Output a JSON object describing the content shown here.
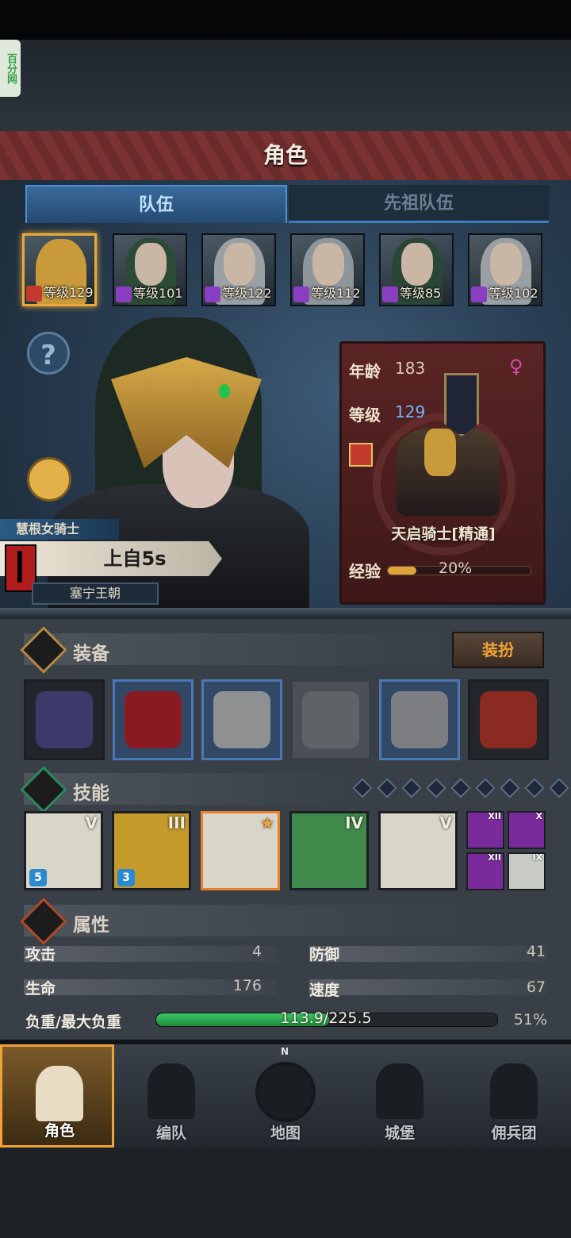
{
  "watermark": "百分网",
  "title": "角色",
  "tabs": [
    {
      "label": "队伍",
      "active": true
    },
    {
      "label": "先祖队伍",
      "active": false
    }
  ],
  "party": [
    {
      "level": "等级129",
      "icon": "horse-icon",
      "selected": true
    },
    {
      "level": "等级101",
      "icon": "wand-icon",
      "selected": false
    },
    {
      "level": "等级122",
      "icon": "wand-icon",
      "selected": false
    },
    {
      "level": "等级112",
      "icon": "wand-icon",
      "selected": false
    },
    {
      "level": "等级85",
      "icon": "wand-icon",
      "selected": false
    },
    {
      "level": "等级102",
      "icon": "wand-icon",
      "selected": false
    }
  ],
  "help_label": "?",
  "hero": {
    "class_title": "慧根女骑士",
    "name": "上自5s",
    "kingdom": "塞宁王朝"
  },
  "card": {
    "age_label": "年龄",
    "age": "183",
    "level_label": "等级",
    "level": "129",
    "gender_symbol": "♀",
    "class_name": "天启骑士[精通]",
    "exp_label": "经验",
    "exp_text": "20%",
    "exp_fraction": 0.2
  },
  "equipment": {
    "title": "装备",
    "outfit_button": "装扮",
    "slots": [
      {
        "name": "banner-lance-icon",
        "frame": "dark",
        "color": "#3b3a6a"
      },
      {
        "name": "red-tome-icon",
        "frame": "blue",
        "color": "#8a1a22"
      },
      {
        "name": "knight-helmet-icon",
        "frame": "blue",
        "color": "#8e9092"
      },
      {
        "name": "empty-armor-icon",
        "frame": "empty",
        "color": "#5e6368"
      },
      {
        "name": "steel-boots-icon",
        "frame": "blue",
        "color": "#7c7e82"
      },
      {
        "name": "bat-amulet-icon",
        "frame": "dark",
        "color": "#8a2a20"
      }
    ]
  },
  "skills": {
    "title": "技能",
    "gem_count": 9,
    "list": [
      {
        "name": "spear-guard-skill-icon",
        "rank": "V",
        "sub": "5",
        "bg": "#d9d6c9"
      },
      {
        "name": "holy-shield-skill-icon",
        "rank": "III",
        "sub": "3",
        "bg": "#c49a2a"
      },
      {
        "name": "crystal-wing-skill-icon",
        "rank": "★",
        "sub": "",
        "bg": "#d9d6c9"
      },
      {
        "name": "target-skill-icon",
        "rank": "IV",
        "sub": "",
        "bg": "#3f8a4a"
      },
      {
        "name": "crystal-arm-skill-icon",
        "rank": "V",
        "sub": "",
        "bg": "#d9d6c9"
      }
    ],
    "mini": [
      {
        "name": "arcane-star-skill-icon",
        "rank": "XII",
        "bg": "#7a2a9a"
      },
      {
        "name": "burst-skill-icon",
        "rank": "X",
        "bg": "#7a2a9a"
      },
      {
        "name": "staff-skill-icon",
        "rank": "XII",
        "bg": "#7a2a9a"
      },
      {
        "name": "frost-burst-skill-icon",
        "rank": "IX",
        "bg": "#c8ccc4"
      }
    ]
  },
  "attributes": {
    "title": "属性",
    "attack_label": "攻击",
    "attack": "4",
    "defense_label": "防御",
    "defense": "41",
    "hp_label": "生命",
    "hp": "176",
    "speed_label": "速度",
    "speed": "67",
    "load_label": "负重/最大负重",
    "load": "113.9/225.5",
    "load_pct": "51%",
    "load_fraction": 0.51
  },
  "nav": [
    {
      "label": "角色",
      "icon": "knight-icon",
      "active": true
    },
    {
      "label": "编队",
      "icon": "helmet-icon",
      "active": false
    },
    {
      "label": "地图",
      "icon": "compass-map-icon",
      "active": false
    },
    {
      "label": "城堡",
      "icon": "castle-icon",
      "active": false
    },
    {
      "label": "佣兵团",
      "icon": "mercenary-icon",
      "active": false
    }
  ],
  "compass_n": "N"
}
